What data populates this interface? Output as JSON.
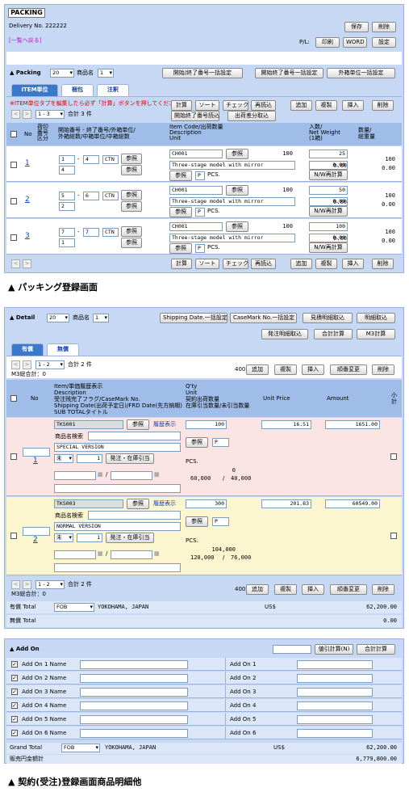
{
  "packing": {
    "title": "PACKING",
    "delivery": "Delivery No. 222222",
    "save": "保存",
    "delete": "削除",
    "back_link": "[一覧へ戻る]",
    "pl_label": "P/L:",
    "print": "印刷",
    "word": "WORD",
    "settings": "設定",
    "section_label": "▲ Packing",
    "count_select": "20",
    "product_label": "商品名",
    "product_select": "1",
    "bulk_open_close": "開始/終了番号一括設定",
    "bulk_open_close2": "開始終了番号一括設定",
    "bulk_outer": "外箱単位一括設定",
    "tabs": [
      "ITEM単位",
      "梱包",
      "注釈"
    ],
    "notice": "※ITEM単位タブを編集したら必ず「計算」ボタンを押してください",
    "toolbar": [
      "計算",
      "ソート",
      "チェック",
      "再読込",
      "追加",
      "複製",
      "挿入",
      "削除"
    ],
    "page_select": "1 - 3",
    "total": "合計 3 件",
    "end_number_read": "開始終了番号読込",
    "ship_diff_read": "出荷差分取込",
    "headers": {
      "no": "No",
      "packing_no": "荷印\n番号\n区分",
      "range": "開始番号 - 終了番号/外箱単位/\n外箱総数/中箱単位/中箱総数",
      "item": "Item Code/出荷数量\nDescription\nUnit",
      "weight": "入数/\nNet Weight\n(1箱)",
      "qty": "数量/\n総重量"
    },
    "rows": [
      {
        "no": "1",
        "start": "1",
        "end": "4",
        "unit": "CTN",
        "sub": "4",
        "ref": "参照",
        "code": "CH001",
        "ref2": "参照",
        "ship": "100",
        "desc": "Three-stage model with mirror",
        "p": "P",
        "pcs": "PCS.",
        "qty": "25",
        "w1": "0.00",
        "w2": "0.00",
        "calc": "N/W再計算",
        "tq": "100",
        "tw": "0.00"
      },
      {
        "no": "2",
        "start": "5",
        "end": "6",
        "unit": "CTN",
        "sub": "2",
        "ref": "参照",
        "code": "CH001",
        "ref2": "参照",
        "ship": "100",
        "desc": "Three-stage model with mirror",
        "p": "P",
        "pcs": "PCS.",
        "qty": "50",
        "w1": "0.00",
        "w2": "0.00",
        "calc": "N/W再計算",
        "tq": "100",
        "tw": "0.00"
      },
      {
        "no": "3",
        "start": "7",
        "end": "7",
        "unit": "CTN",
        "sub": "1",
        "ref": "参照",
        "code": "CH001",
        "ref2": "参照",
        "ship": "100",
        "desc": "Three-stage model with mirror",
        "p": "P",
        "pcs": "PCS.",
        "qty": "100",
        "w1": "0.00",
        "w2": "0.00",
        "calc": "N/W再計算",
        "tq": "100",
        "tw": "0.00"
      }
    ],
    "caption": "▲ パッキング登録画面"
  },
  "detail": {
    "section_label": "▲ Detail",
    "count_select": "20",
    "product_label": "商品名",
    "product_select": "1",
    "bulk_ship": "Shipping Date.一括設定",
    "bulk_casemark": "CaseMark No.一括設定",
    "quote_read": "見積明細取込",
    "detail_read": "明細取込",
    "order_read": "発注明細取込",
    "total_calc": "合計計算",
    "m3_calc": "M3計算",
    "tabs": [
      "有償",
      "無償"
    ],
    "page_select": "1 - 2",
    "total": "合計 2 件",
    "m3_total": "M3総合計：0",
    "per_page": "400",
    "toolbar": [
      "追加",
      "複製",
      "挿入",
      "順番変更",
      "削除"
    ],
    "headers": {
      "no": "No",
      "item": "Item/単価履歴表示\nDescription\n受注残完了フラグ/CaseMark No.\nShipping Date(出荷予定日)/FRD Date(先方納期)\nSUB TOTALタイトル",
      "qty": "Q'ty\nUnit\n契約出荷数量\n在庫引当数量/未引当数量",
      "price": "Unit Price",
      "amount": "Amount",
      "sub": "小\n計"
    },
    "rows": [
      {
        "no": "1",
        "code": "TKS001",
        "ref": "参照",
        "history": "履歴表示",
        "search": "商品名検索",
        "version": "SPECIAL VERSION",
        "flag": "未",
        "num": "1",
        "order": "発注・在庫引当",
        "qty": "100",
        "ref2": "参照",
        "p": "P",
        "pcs": "PCS.",
        "stock": "0",
        "alloc": "60,000",
        "unalloc": "40,000",
        "price": "16.51",
        "amount": "1651.00"
      },
      {
        "no": "2",
        "code": "TKS003",
        "ref": "参照",
        "history": "履歴表示",
        "search": "商品名検索",
        "version": "NORMAL VERSION",
        "flag": "未",
        "num": "1",
        "order": "発注・在庫引当",
        "qty": "300",
        "ref2": "参照",
        "p": "P",
        "pcs": "PCS.",
        "stock": "104,000",
        "alloc": "120,000",
        "unalloc": "76,000",
        "price": "201.83",
        "amount": "60549.00"
      }
    ],
    "paid_total_label": "有償 Total",
    "paid_term": "FOB",
    "paid_port": "YOKOHAMA, JAPAN",
    "paid_currency": "US$",
    "paid_amount": "62,200.00",
    "free_total_label": "無償 Total",
    "free_amount": "0.00",
    "addon_label": "▲ Add On",
    "addon_recalc": "値引計算(N)",
    "addon_total": "合計計算",
    "addons_left": [
      "Add On 1 Name",
      "Add On 2 Name",
      "Add On 3 Name",
      "Add On 4 Name",
      "Add On 5 Name",
      "Add On 6 Name"
    ],
    "addons_right": [
      "Add On 1",
      "Add On 2",
      "Add On 3",
      "Add On 4",
      "Add On 5",
      "Add On 6"
    ],
    "grand_label": "Grand Total",
    "grand_term": "FOB",
    "grand_port": "YOKOHAMA, JAPAN",
    "grand_currency": "US$",
    "grand_amount": "62,200.00",
    "sales_label": "販売円金額計",
    "sales_amount": "6,779,800.00",
    "caption": "▲ 契約(受注)登録画面商品明細他"
  },
  "colors": {
    "panel": "#c6d8f4",
    "header": "#9fbde8",
    "pink": "#fbe4e4",
    "yellow": "#fbf6cf",
    "tab": "#3a78c9"
  }
}
